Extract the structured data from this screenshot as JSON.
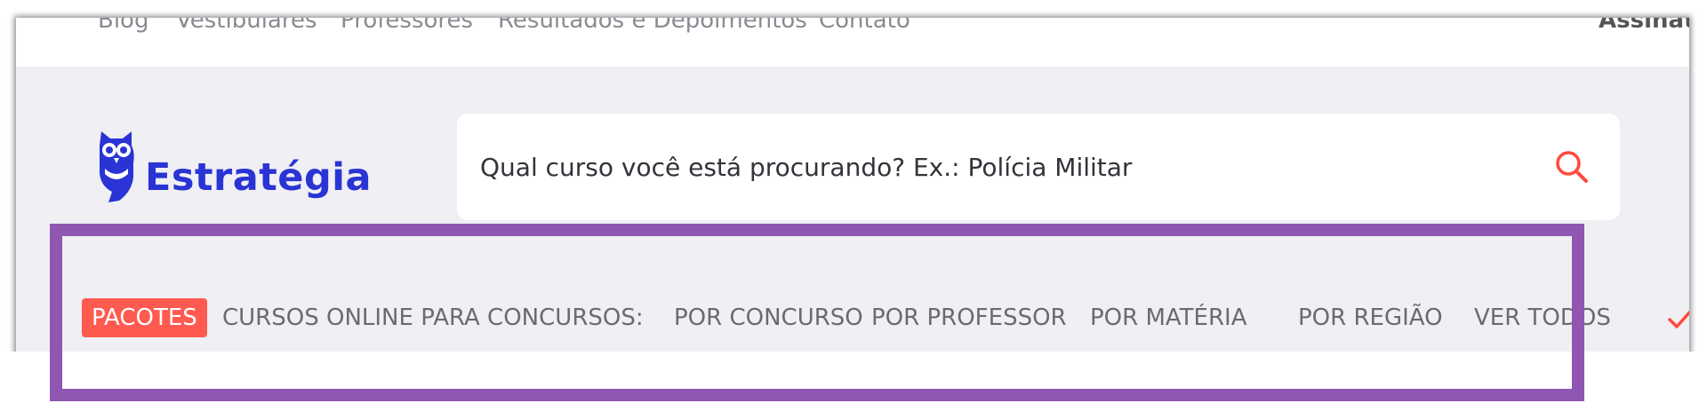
{
  "top_nav": {
    "links": [
      "Blog",
      "Vestibulares",
      "Professores",
      "Resultados e Depoimentos",
      "Contato"
    ],
    "cta": "Assinatu"
  },
  "logo": {
    "text": "Estratégia",
    "icon": "owl-icon",
    "color": "#2a34d4"
  },
  "search": {
    "placeholder": "Qual curso você está procurando? Ex.: Polícia Militar",
    "value": "",
    "icon": "search-icon",
    "icon_color": "#ff4a3d"
  },
  "menu": {
    "badge": "PACOTES",
    "badge_color": "#ff5a4f",
    "items": [
      "CURSOS ONLINE PARA CONCURSOS:",
      "POR CONCURSO",
      "POR PROFESSOR",
      "POR MATÉRIA",
      "POR REGIÃO",
      "VER TODOS"
    ]
  },
  "annotation": {
    "highlight_color": "#8f57b1"
  },
  "check_icon": "check-icon"
}
